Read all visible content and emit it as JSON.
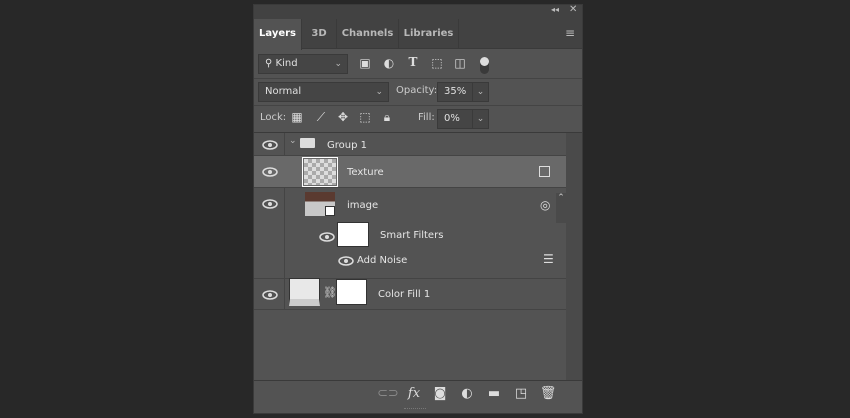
{
  "tabs": [
    "Layers",
    "3D",
    "Channels",
    "Libraries"
  ],
  "filter": {
    "kind": "Kind"
  },
  "blend_mode": "Normal",
  "opacity": {
    "label": "Opacity:",
    "value": "35%"
  },
  "lock": {
    "label": "Lock:"
  },
  "fill": {
    "label": "Fill:",
    "value": "0%"
  },
  "layers": {
    "group": "Group 1",
    "texture": "Texture",
    "image": "image",
    "smart_filters": "Smart Filters",
    "add_noise": "Add Noise",
    "color_fill": "Color Fill 1"
  }
}
